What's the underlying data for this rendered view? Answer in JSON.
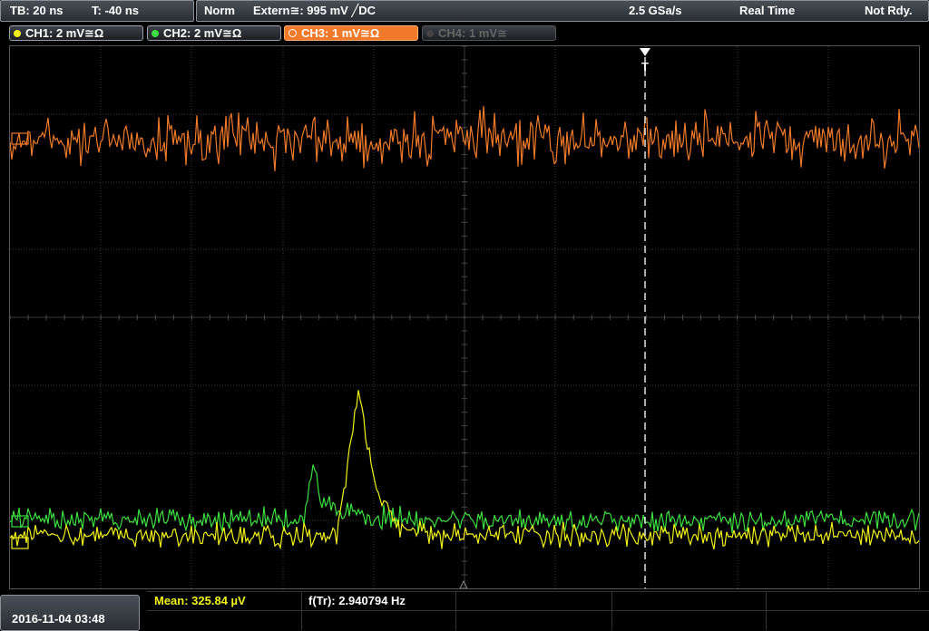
{
  "topbar": {
    "timebase": "TB: 20 ns",
    "trigger_time": "T: -40 ns",
    "mode": "Norm",
    "trigger": "Extern≅: 995 mV ╱DC",
    "sample_rate": "2.5 GSa/s",
    "acq_mode": "Real Time",
    "status": "Not Rdy."
  },
  "channels": [
    {
      "label": "CH1: 2 mV≅Ω",
      "color": "#f2f21a",
      "state": "on"
    },
    {
      "label": "CH2: 2 mV≅Ω",
      "color": "#3ce040",
      "state": "on"
    },
    {
      "label": "CH3: 1 mV≅Ω",
      "color": "#f07a2a",
      "state": "active"
    },
    {
      "label": "CH4: 1 mV≅",
      "color": "#666666",
      "state": "off"
    }
  ],
  "trigger_marker": "T",
  "bottombar": {
    "datetime": "2016-11-04 03:48",
    "measurement_1": "Mean: 325.84 µV",
    "measurement_2": "f(Tr): 2.940794 Hz"
  },
  "colors": {
    "ch1": "#f2f21a",
    "ch2": "#3ce040",
    "ch3": "#f07a2a",
    "grid": "#3a3a3a"
  }
}
